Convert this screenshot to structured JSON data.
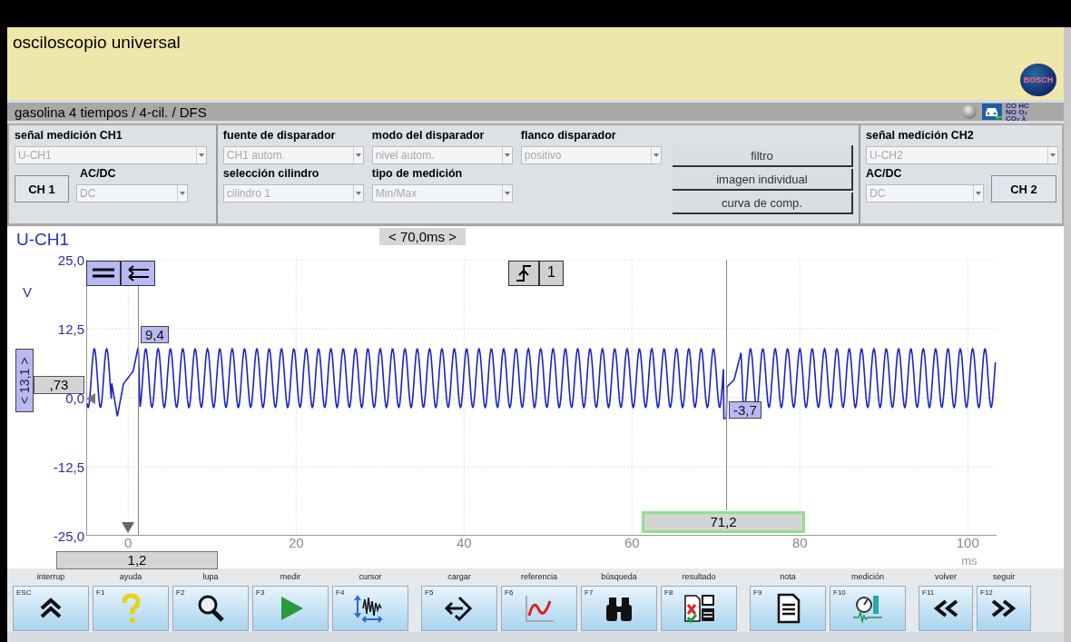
{
  "app": {
    "title": "osciloscopio universal",
    "logo_text": "BOSCH"
  },
  "status_bar": {
    "text": "gasolina 4 tiempos /  4-cil. / DFS",
    "emissions_lines": [
      "CO HC",
      "NO O₂",
      "CO₂ λ"
    ]
  },
  "settings": {
    "ch1": {
      "label": "señal medición CH1",
      "signal": {
        "value": "U-CH1",
        "disabled": true
      },
      "button": "CH 1",
      "acdc_label": "AC/DC",
      "acdc": {
        "value": "DC",
        "disabled": true
      }
    },
    "fields": [
      {
        "label": "fuente de disparador",
        "value": "CH1 autom.",
        "disabled": true
      },
      {
        "label": "modo del disparador",
        "value": "nivel autom.",
        "disabled": true
      },
      {
        "label": "flanco disparador",
        "value": "positivo",
        "disabled": true
      },
      {
        "label": "selección cilindro",
        "value": "cilindro 1",
        "disabled": true
      },
      {
        "label": "tipo de medición",
        "value": "Min/Max",
        "disabled": true
      }
    ],
    "buttons": [
      "filtro",
      "imagen individual",
      "curva de comp."
    ],
    "ch2": {
      "label": "señal medición CH2",
      "signal": {
        "value": "U-CH2",
        "disabled": true
      },
      "button": "CH 2",
      "acdc_label": "AC/DC",
      "acdc": {
        "value": "DC",
        "disabled": true
      }
    }
  },
  "plot": {
    "channel": "U-CH1",
    "timebase": "< 70,0ms >",
    "y_unit": "V",
    "x_unit": "ms",
    "y_labels": [
      "25,0",
      "12,5",
      "0,0",
      "-12,5",
      "-25,0"
    ],
    "x_labels": [
      "0",
      "20",
      "40",
      "60",
      "80",
      "100"
    ],
    "trigger_channel": "1",
    "level_range": "< 13,1 >",
    "level_value": ",73",
    "markers": [
      {
        "text": "9,4"
      },
      {
        "text": "-3,7"
      }
    ],
    "cursors": [
      {
        "text": "1,2",
        "selected": false
      },
      {
        "text": "71,2",
        "selected": true
      }
    ]
  },
  "function_keys": [
    [
      {
        "key": "ESC",
        "label": "interrup",
        "kind": "chevrons"
      },
      {
        "key": "F1",
        "label": "ayuda",
        "kind": "question"
      },
      {
        "key": "F2",
        "label": "lupa",
        "kind": "magnifier"
      },
      {
        "key": "F3",
        "label": "medir",
        "kind": "play"
      },
      {
        "key": "F4",
        "label": "cursor",
        "kind": "cursor"
      }
    ],
    [
      {
        "key": "F5",
        "label": "cargar",
        "kind": "load"
      },
      {
        "key": "F6",
        "label": "referencia",
        "kind": "curve"
      },
      {
        "key": "F7",
        "label": "búsqueda",
        "kind": "binoculars"
      },
      {
        "key": "F8",
        "label": "resultado",
        "kind": "result"
      }
    ],
    [
      {
        "key": "F9",
        "label": "nota",
        "kind": "note"
      },
      {
        "key": "F10",
        "label": "medición",
        "kind": "measure"
      }
    ],
    [
      {
        "key": "F11",
        "label": "volver",
        "kind": "back"
      },
      {
        "key": "F12",
        "label": "seguir",
        "kind": "forward"
      }
    ]
  ]
}
